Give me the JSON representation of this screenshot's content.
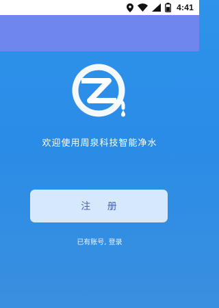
{
  "status_bar": {
    "time": "4:41",
    "icons": [
      "location-icon",
      "wifi-icon",
      "signal-icon",
      "battery-icon"
    ]
  },
  "logo": {
    "name": "zhouquan-z-water-drop-logo"
  },
  "welcome": {
    "text": "欢迎使用周泉科技智能净水"
  },
  "buttons": {
    "register_label": "注 册"
  },
  "links": {
    "login_text": "已有账号, 登录"
  },
  "colors": {
    "background": "#2f93ea",
    "app_bar": "#6f86ee",
    "button_bg": "#d6e8fb",
    "button_text": "#4a62b6",
    "white": "#ffffff"
  }
}
